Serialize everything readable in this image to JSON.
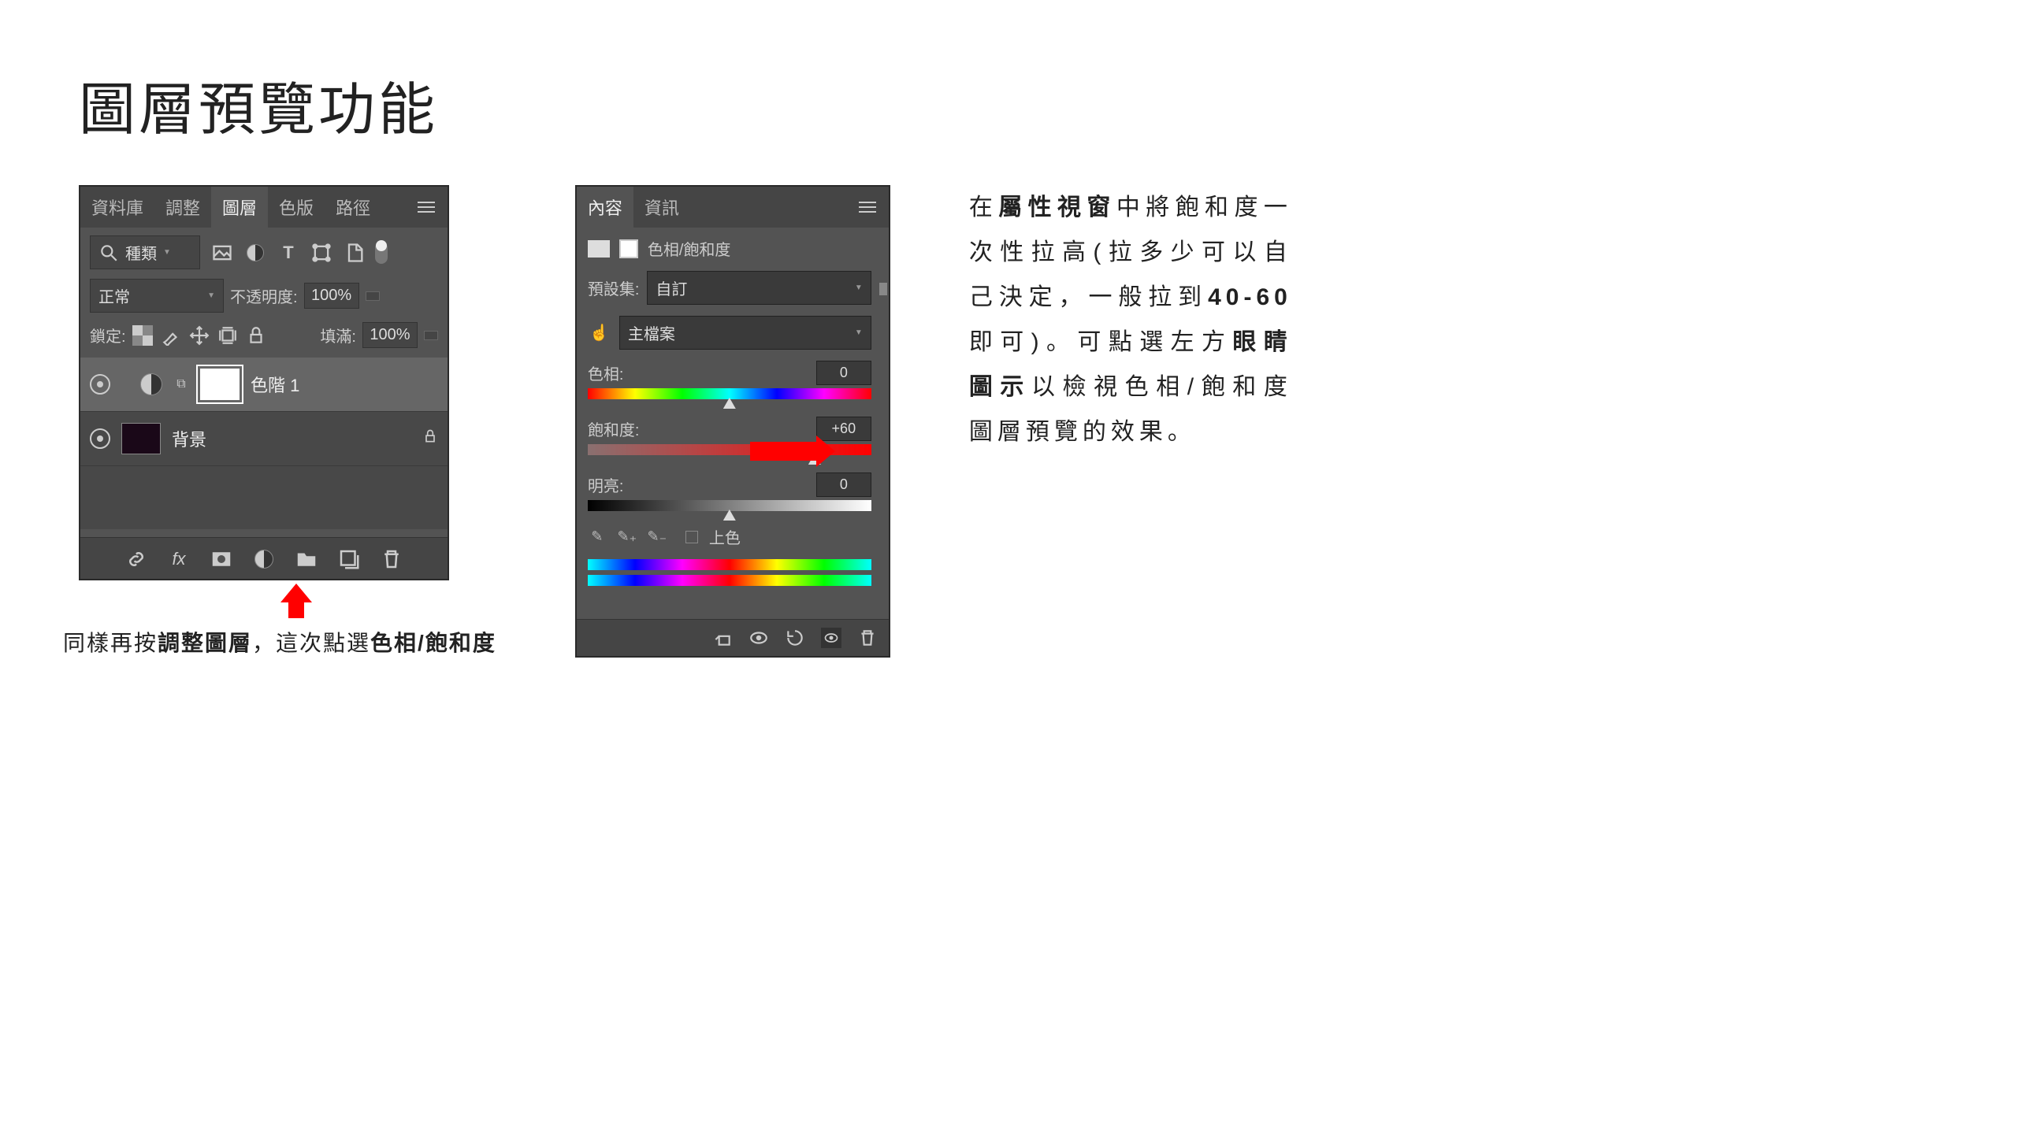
{
  "title": "圖層預覽功能",
  "layers_panel": {
    "tabs": [
      "資料庫",
      "調整",
      "圖層",
      "色版",
      "路徑"
    ],
    "active_tab": 2,
    "filter_label": "種類",
    "blend_mode": "正常",
    "opacity_label": "不透明度:",
    "opacity_value": "100%",
    "lock_label": "鎖定:",
    "fill_label": "填滿:",
    "fill_value": "100%",
    "layer1_name": "色階 1",
    "layer2_name": "背景"
  },
  "caption_parts": {
    "p1": "同樣再按",
    "b1": "調整圖層",
    "p2": "，這次點選",
    "b2": "色相/飽和度"
  },
  "props_panel": {
    "tabs": [
      "內容",
      "資訊"
    ],
    "active_tab": 0,
    "header": "色相/飽和度",
    "preset_label": "預設集:",
    "preset_value": "自訂",
    "master_value": "主檔案",
    "hue_label": "色相:",
    "hue_value": "0",
    "sat_label": "飽和度:",
    "sat_value": "+60",
    "lig_label": "明亮:",
    "lig_value": "0",
    "colorize_label": "上色"
  },
  "desc_parts": {
    "p1": "在",
    "b1": "屬性視窗",
    "p2": "中將飽和度一次性拉高(拉多少可以自己決定，一般拉到",
    "b2": "40-60",
    "p3": "即可)。可點選左方",
    "b3": "眼睛圖示",
    "p4": "以檢視色相/飽和度圖層預覽的效果。"
  }
}
